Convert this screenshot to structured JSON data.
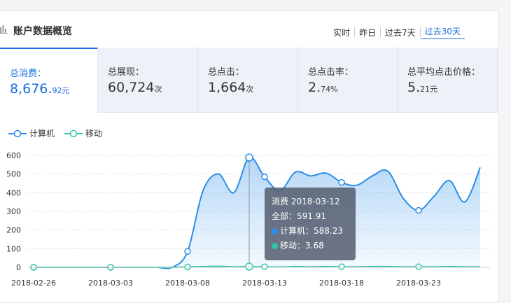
{
  "header": {
    "title": "账户数据概览",
    "ranges": [
      {
        "label": "实时",
        "active": false
      },
      {
        "label": "昨日",
        "active": false
      },
      {
        "label": "过去7天",
        "active": false
      },
      {
        "label": "过去30天",
        "active": true
      }
    ]
  },
  "metrics": [
    {
      "label": "总消费：",
      "value_main": "8,676.",
      "value_small": "92元",
      "active": true
    },
    {
      "label": "总展现：",
      "value_main": "60,724",
      "value_small": "次",
      "active": false
    },
    {
      "label": "总点击：",
      "value_main": "1,664",
      "value_small": "次",
      "active": false
    },
    {
      "label": "总点击率：",
      "value_main": "2.",
      "value_small": "74%",
      "active": false
    },
    {
      "label": "总平均点击价格：",
      "value_main": "5.",
      "value_small": "21元",
      "active": false
    }
  ],
  "legend": [
    {
      "name": "计算机",
      "color": "#2b8de8"
    },
    {
      "name": "移动",
      "color": "#2ec7a8"
    }
  ],
  "tooltip": {
    "title": "消费 2018-03-12",
    "total": "全部：591.91",
    "computer": "计算机：588.23",
    "mobile": "移动：3.68"
  },
  "chart_data": {
    "type": "area",
    "x_tick_labels": [
      "2018-02-26",
      "2018-03-03",
      "2018-03-08",
      "2018-03-13",
      "2018-03-18",
      "2018-03-23"
    ],
    "y_ticks": [
      0,
      100,
      200,
      300,
      400,
      500,
      600
    ],
    "ylim": [
      0,
      600
    ],
    "grid": true,
    "legend_placement": "top-left",
    "series": [
      {
        "name": "计算机",
        "values": [
          0,
          0,
          0,
          0,
          0,
          0,
          0,
          0,
          0,
          0,
          85,
          410,
          500,
          400,
          588.23,
          485,
          410,
          510,
          490,
          505,
          455,
          440,
          490,
          515,
          370,
          305,
          380,
          465,
          350,
          535
        ]
      },
      {
        "name": "移动",
        "values": [
          0,
          0,
          0,
          0,
          0,
          0,
          0,
          0,
          0,
          0,
          2,
          4,
          5,
          3,
          3.68,
          3,
          2,
          4,
          3,
          4,
          3,
          3,
          4,
          4,
          3,
          3,
          3,
          4,
          3,
          3
        ]
      }
    ]
  }
}
